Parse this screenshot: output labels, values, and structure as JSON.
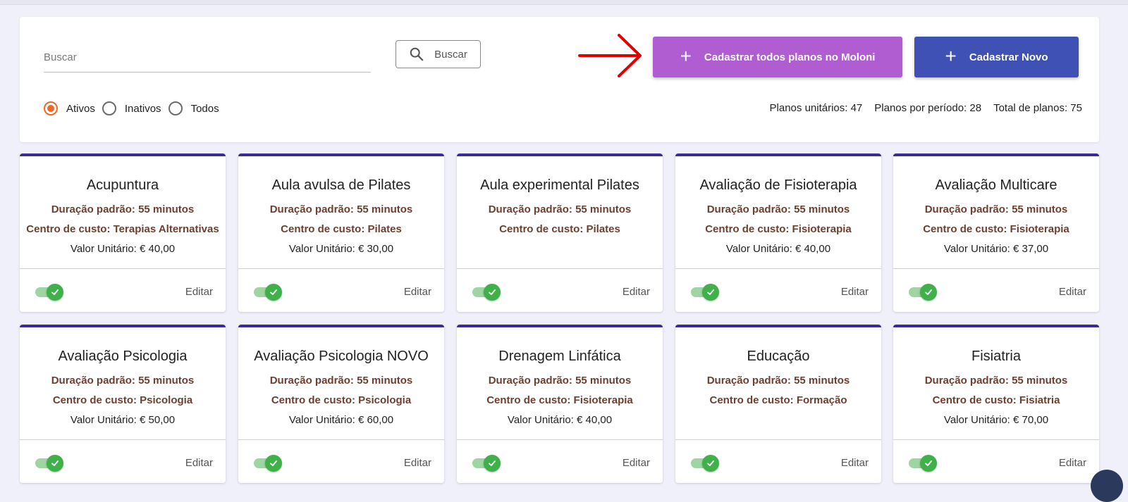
{
  "search": {
    "placeholder": "Buscar",
    "value": "",
    "button_label": "Buscar"
  },
  "actions": {
    "moloni_label": "Cadastrar todos planos no Moloni",
    "novo_label": "Cadastrar Novo",
    "plus_symbol": "+",
    "moloni_color": "#b05dd2",
    "novo_color": "#3f51b5"
  },
  "filters": {
    "options": [
      "Ativos",
      "Inativos",
      "Todos"
    ],
    "selected": "Ativos",
    "accent": "#f26722"
  },
  "counts": {
    "unitarios": "Planos unitários: 47",
    "periodo": "Planos por período: 28",
    "total": "Total de planos: 75"
  },
  "card_edit_label": "Editar",
  "plans": [
    {
      "name": "Acupuntura",
      "duracao": "Duração padrão: 55 minutos",
      "centro": "Centro de custo: Terapias Alternativas",
      "valor": "Valor Unitário: € 40,00",
      "active": true
    },
    {
      "name": "Aula avulsa de Pilates",
      "duracao": "Duração padrão: 55 minutos",
      "centro": "Centro de custo: Pilates",
      "valor": "Valor Unitário: € 30,00",
      "active": true
    },
    {
      "name": "Aula experimental Pilates",
      "duracao": "Duração padrão: 55 minutos",
      "centro": "Centro de custo: Pilates",
      "valor": "",
      "active": true
    },
    {
      "name": "Avaliação de Fisioterapia",
      "duracao": "Duração padrão: 55 minutos",
      "centro": "Centro de custo: Fisioterapia",
      "valor": "Valor Unitário: € 40,00",
      "active": true
    },
    {
      "name": "Avaliação Multicare",
      "duracao": "Duração padrão: 55 minutos",
      "centro": "Centro de custo: Fisioterapia",
      "valor": "Valor Unitário: € 37,00",
      "active": true
    },
    {
      "name": "Avaliação Psicologia",
      "duracao": "Duração padrão: 55 minutos",
      "centro": "Centro de custo: Psicologia",
      "valor": "Valor Unitário: € 50,00",
      "active": true
    },
    {
      "name": "Avaliação Psicologia NOVO",
      "duracao": "Duração padrão: 55 minutos",
      "centro": "Centro de custo: Psicologia",
      "valor": "Valor Unitário: € 60,00",
      "active": true
    },
    {
      "name": "Drenagem Linfática",
      "duracao": "Duração padrão: 55 minutos",
      "centro": "Centro de custo: Fisioterapia",
      "valor": "Valor Unitário: € 40,00",
      "active": true
    },
    {
      "name": "Educação",
      "duracao": "Duração padrão: 55 minutos",
      "centro": "Centro de custo: Formação",
      "valor": "",
      "active": true
    },
    {
      "name": "Fisiatria",
      "duracao": "Duração padrão: 55 minutos",
      "centro": "Centro de custo: Fisiatria",
      "valor": "Valor Unitário: € 70,00",
      "active": true
    }
  ],
  "colors": {
    "card_top_border": "#3c2a95",
    "card_detail_text": "#6e3f2f",
    "toggle_on": "#3fb04a",
    "annotation_arrow": "#e00000"
  }
}
